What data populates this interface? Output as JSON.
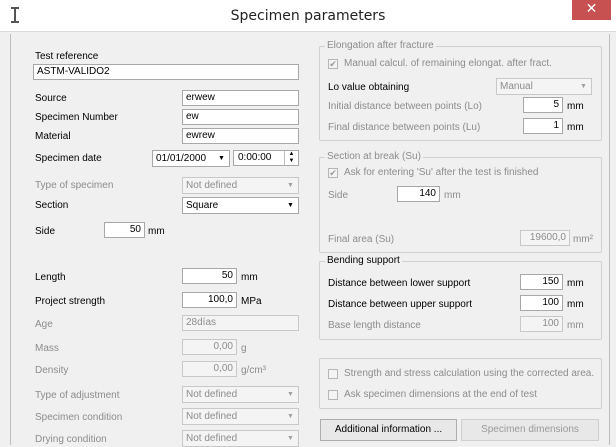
{
  "window": {
    "title": "Specimen parameters"
  },
  "left": {
    "test_reference": {
      "label": "Test reference",
      "value": "ASTM-VALIDO2"
    },
    "source": {
      "label": "Source",
      "value": "erwew"
    },
    "specimen_number": {
      "label": "Specimen Number",
      "value": "ew"
    },
    "material": {
      "label": "Material",
      "value": "ewrew"
    },
    "specimen_date": {
      "label": "Specimen date",
      "date": "01/01/2000",
      "time": "0:00:00"
    },
    "type_of_specimen": {
      "label": "Type of specimen",
      "value": "Not defined"
    },
    "section": {
      "label": "Section",
      "value": "Square"
    },
    "side": {
      "label": "Side",
      "value": "50",
      "unit": "mm"
    },
    "length": {
      "label": "Length",
      "value": "50",
      "unit": "mm"
    },
    "project_strength": {
      "label": "Project strength",
      "value": "100,0",
      "unit": "MPa"
    },
    "age": {
      "label": "Age",
      "value": "28días"
    },
    "mass": {
      "label": "Mass",
      "value": "0,00",
      "unit": "g"
    },
    "density": {
      "label": "Density",
      "value": "0,00",
      "unit": "g/cm³"
    },
    "type_of_adjustment": {
      "label": "Type of adjustment",
      "value": "Not defined"
    },
    "specimen_condition": {
      "label": "Specimen condition",
      "value": "Not defined"
    },
    "drying_condition": {
      "label": "Drying condition",
      "value": "Not defined"
    }
  },
  "elongation": {
    "legend": "Elongation after fracture",
    "manual_calc": {
      "label": "Manual calcul. of remaining elongat. after fract.",
      "checked": true
    },
    "lo_obtaining": {
      "label": "Lo value obtaining",
      "value": "Manual"
    },
    "initial_distance": {
      "label": "Initial distance between points (Lo)",
      "value": "5",
      "unit": "mm"
    },
    "final_distance": {
      "label": "Final distance between points (Lu)",
      "value": "1",
      "unit": "mm"
    }
  },
  "section_break": {
    "legend": "Section at break (Su)",
    "ask_su": {
      "label": "Ask for entering 'Su' after the test is finished",
      "checked": true
    },
    "side": {
      "label": "Side",
      "value": "140",
      "unit": "mm"
    },
    "final_area": {
      "label": "Final area (Su)",
      "value": "19600,0",
      "unit": "mm²"
    }
  },
  "bending": {
    "legend": "Bending support",
    "lower": {
      "label": "Distance between lower support",
      "value": "150",
      "unit": "mm"
    },
    "upper": {
      "label": "Distance between upper support",
      "value": "100",
      "unit": "mm"
    },
    "base_length": {
      "label": "Base length distance",
      "value": "100",
      "unit": "mm"
    }
  },
  "options": {
    "strength_corrected": {
      "label": "Strength and stress calculation using the corrected area.",
      "checked": false
    },
    "ask_dimensions": {
      "label": "Ask specimen dimensions at the end of test",
      "checked": false
    }
  },
  "buttons": {
    "additional_info": "Additional information ...",
    "specimen_dimensions": "Specimen dimensions"
  },
  "icons": {
    "close": "close-icon",
    "dropdown": "chevron-down-icon",
    "spin": "spin-arrows-icon",
    "app": "app-icon"
  },
  "colors": {
    "close_button": "#c75050",
    "disabled_text": "#8c8c8c",
    "window_bg": "#f0f0f0"
  }
}
